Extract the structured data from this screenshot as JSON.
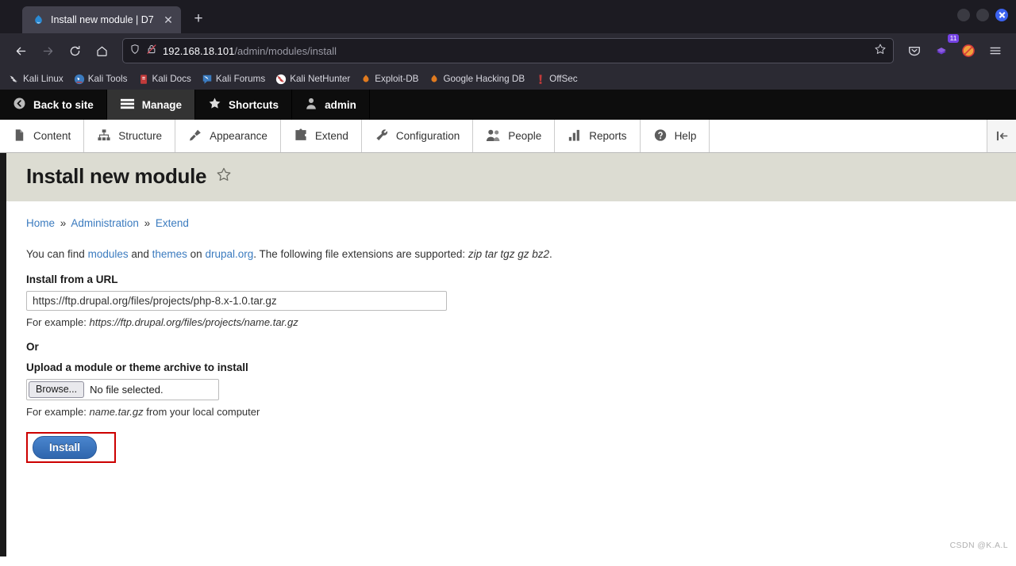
{
  "browser": {
    "tab": {
      "title": "Install new module | D7",
      "favicon": "drupal-droplet-icon",
      "close": "✕"
    },
    "newtab_label": "+",
    "window_controls": {
      "minimize": "minimize",
      "maximize": "maximize",
      "close": "close"
    },
    "nav": {
      "back": "back-icon",
      "forward": "forward-icon",
      "reload": "reload-icon",
      "home": "home-icon"
    },
    "urlbar": {
      "shield_icon": "shield-icon",
      "lock_icon": "insecure-lock-icon",
      "url_host": "192.168.18.101",
      "url_path": "/admin/modules/install",
      "bookmark_icon": "star-outline-icon"
    },
    "toolbar_right": {
      "pocket": "pocket-icon",
      "extension_badge": "11",
      "extension_blocked": "blocked-extension-icon",
      "menu": "hamburger-menu-icon"
    },
    "bookmarks": [
      {
        "label": "Kali Linux",
        "icon": "kali-dragon-icon"
      },
      {
        "label": "Kali Tools",
        "icon": "kali-tools-icon"
      },
      {
        "label": "Kali Docs",
        "icon": "kali-docs-icon"
      },
      {
        "label": "Kali Forums",
        "icon": "kali-forums-icon"
      },
      {
        "label": "Kali NetHunter",
        "icon": "kali-nethunter-icon"
      },
      {
        "label": "Exploit-DB",
        "icon": "exploit-db-icon"
      },
      {
        "label": "Google Hacking DB",
        "icon": "google-hacking-db-icon"
      },
      {
        "label": "OffSec",
        "icon": "offsec-icon"
      }
    ]
  },
  "admin_toolbar": {
    "top": [
      {
        "label": "Back to site",
        "icon": "chevron-left-circle-icon",
        "active": false
      },
      {
        "label": "Manage",
        "icon": "hamburger-icon",
        "active": true
      },
      {
        "label": "Shortcuts",
        "icon": "star-icon",
        "active": false
      },
      {
        "label": "admin",
        "icon": "user-icon",
        "active": false
      }
    ],
    "sub": [
      {
        "label": "Content",
        "icon": "file-icon"
      },
      {
        "label": "Structure",
        "icon": "sitemap-icon"
      },
      {
        "label": "Appearance",
        "icon": "paintbrush-icon"
      },
      {
        "label": "Extend",
        "icon": "puzzle-piece-icon"
      },
      {
        "label": "Configuration",
        "icon": "wrench-icon"
      },
      {
        "label": "People",
        "icon": "people-icon"
      },
      {
        "label": "Reports",
        "icon": "bar-chart-icon"
      },
      {
        "label": "Help",
        "icon": "question-circle-icon"
      }
    ],
    "orientation_toggle": "vertical-orientation-icon"
  },
  "main": {
    "title": "Install new module",
    "title_star_icon": "star-outline-icon",
    "breadcrumb": [
      {
        "label": "Home"
      },
      {
        "label": "Administration"
      },
      {
        "label": "Extend"
      }
    ],
    "breadcrumb_separator": "»",
    "intro": {
      "part1": "You can find ",
      "link_modules": "modules",
      "part2": " and ",
      "link_themes": "themes",
      "part3": " on ",
      "link_drupal": "drupal.org",
      "part4": ". The following file extensions are supported: ",
      "extensions": "zip tar tgz gz bz2",
      "part5": "."
    },
    "url_field": {
      "label": "Install from a URL",
      "value": "https://ftp.drupal.org/files/projects/php-8.x-1.0.tar.gz",
      "placeholder": "",
      "hint_prefix": "For example: ",
      "hint_example": "https://ftp.drupal.org/files/projects/name.tar.gz"
    },
    "or_label": "Or",
    "upload_field": {
      "label": "Upload a module or theme archive to install",
      "browse_label": "Browse...",
      "file_status": "No file selected.",
      "hint_prefix": "For example: ",
      "hint_example": "name.tar.gz",
      "hint_suffix": " from your local computer"
    },
    "submit_label": "Install",
    "highlight_color": "#cc0000"
  },
  "watermark": "CSDN @K.A.L"
}
